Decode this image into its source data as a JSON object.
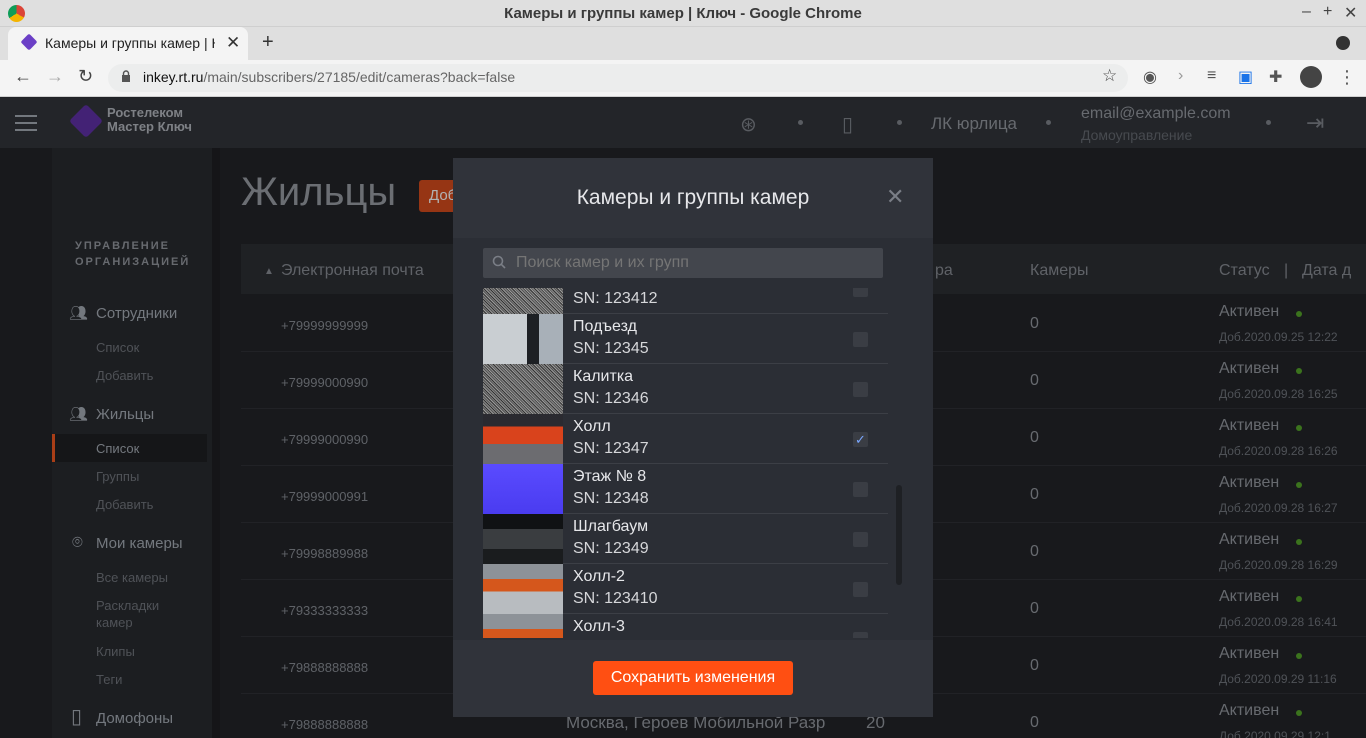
{
  "window": {
    "title": "Камеры и группы камер | Ключ - Google Chrome"
  },
  "tab": {
    "title": "Камеры и группы камер | Ключ"
  },
  "address": {
    "host": "inkey.rt.ru",
    "path": "/main/subscribers/27185/edit/cameras?back=false"
  },
  "header": {
    "logo_line1": "Ростелеком",
    "logo_line2": "Мастер Ключ",
    "account_type": "ЛК юрлица",
    "email": "email@example.com",
    "org": "Домоуправление"
  },
  "sidebar": {
    "heading_line1": "УПРАВЛЕНИЕ",
    "heading_line2": "ОРГАНИЗАЦИЕЙ",
    "employees": {
      "label": "Сотрудники",
      "items": [
        "Список",
        "Добавить"
      ]
    },
    "residents": {
      "label": "Жильцы",
      "items": [
        "Список",
        "Группы",
        "Добавить"
      ]
    },
    "cameras": {
      "label": "Мои камеры",
      "items": [
        "Все камеры",
        "Раскладки",
        "камер",
        "Клипы",
        "Теги"
      ]
    },
    "intercoms": {
      "label": "Домофоны"
    }
  },
  "page": {
    "title": "Жильцы",
    "add_label": "Добавить"
  },
  "table": {
    "headers": {
      "email": "Электронная почта",
      "address_tail": "ра",
      "cameras": "Камеры",
      "status": "Статус",
      "sep": "|",
      "date": "Дата д"
    },
    "rows": [
      {
        "phone": "+79999999999",
        "cameras": "0",
        "status": "Активен",
        "date": "Доб.2020.09.25 12:22"
      },
      {
        "phone": "+79999000990",
        "cameras": "0",
        "status": "Активен",
        "date": "Доб.2020.09.28 16:25"
      },
      {
        "phone": "+79999000990",
        "cameras": "0",
        "status": "Активен",
        "date": "Доб.2020.09.28 16:26"
      },
      {
        "phone": "+79999000991",
        "cameras": "0",
        "status": "Активен",
        "date": "Доб.2020.09.28 16:27"
      },
      {
        "phone": "+79998889988",
        "cameras": "0",
        "status": "Активен",
        "date": "Доб.2020.09.28 16:29"
      },
      {
        "phone": "+79333333333",
        "cameras": "0",
        "status": "Активен",
        "date": "Доб.2020.09.28 16:41"
      },
      {
        "phone": "+79888888888",
        "cameras": "0",
        "status": "Активен",
        "date": "Доб.2020.09.29 11:16"
      },
      {
        "phone": "+79888888888",
        "address": "Москва, Героев Мобильной Разр",
        "apt": "20",
        "cameras": "0",
        "status": "Активен",
        "date": "Доб.2020.09.29 12:1"
      }
    ]
  },
  "modal": {
    "title": "Камеры и группы камер",
    "search_placeholder": "Поиск камер и их групп",
    "save_label": "Сохранить изменения",
    "cameras": [
      {
        "name": "",
        "sn": "SN: 123412",
        "checked": false,
        "thumb": "noise"
      },
      {
        "name": "Подъезд",
        "sn": "SN: 12345",
        "checked": false,
        "thumb": "entrance"
      },
      {
        "name": "Калитка",
        "sn": "SN: 12346",
        "checked": false,
        "thumb": "noise"
      },
      {
        "name": "Холл",
        "sn": "SN: 12347",
        "checked": true,
        "thumb": "hall"
      },
      {
        "name": "Этаж № 8",
        "sn": "SN: 12348",
        "checked": false,
        "thumb": "blue"
      },
      {
        "name": "Шлагбаум",
        "sn": "SN: 12349",
        "checked": false,
        "thumb": "barrier"
      },
      {
        "name": "Холл-2",
        "sn": "SN: 123410",
        "checked": false,
        "thumb": "hall2"
      },
      {
        "name": "Холл-3",
        "sn": "",
        "checked": false,
        "thumb": "hall2"
      }
    ]
  }
}
